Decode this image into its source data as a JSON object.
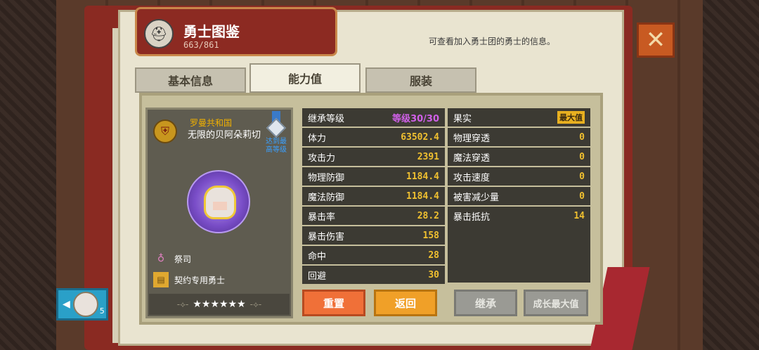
{
  "header": {
    "title": "勇士图鉴",
    "count": "663/861",
    "hint": "可查看加入勇士团的勇士的信息。"
  },
  "tabs": [
    {
      "label": "基本信息",
      "active": false
    },
    {
      "label": "能力值",
      "active": true
    },
    {
      "label": "服装",
      "active": false
    }
  ],
  "hero": {
    "nation": "罗曼共和国",
    "name": "无限的贝阿朵莉切",
    "max_level_label": "达到最高等级",
    "class": "祭司",
    "type": "契约专用勇士",
    "stars": "★★★★★★"
  },
  "stats_left": [
    {
      "label": "继承等级",
      "value": "等级30/30"
    },
    {
      "label": "体力",
      "value": "63502.4"
    },
    {
      "label": "攻击力",
      "value": "2391"
    },
    {
      "label": "物理防御",
      "value": "1184.4"
    },
    {
      "label": "魔法防御",
      "value": "1184.4"
    },
    {
      "label": "暴击率",
      "value": "28.2"
    },
    {
      "label": "暴击伤害",
      "value": "158"
    },
    {
      "label": "命中",
      "value": "28"
    },
    {
      "label": "回避",
      "value": "30"
    }
  ],
  "stats_right": [
    {
      "label": "果实",
      "value": "最大值"
    },
    {
      "label": "物理穿透",
      "value": "0"
    },
    {
      "label": "魔法穿透",
      "value": "0"
    },
    {
      "label": "攻击速度",
      "value": "0"
    },
    {
      "label": "被害减少量",
      "value": "0"
    },
    {
      "label": "暴击抵抗",
      "value": "14"
    }
  ],
  "buttons": {
    "reset": "重置",
    "back": "返回",
    "inherit": "继承",
    "growth_max": "成长最大值"
  },
  "close_label": "✕",
  "avatar": {
    "count": "5"
  },
  "icons": {
    "close": "close-icon",
    "helmet": "helmet-icon",
    "crest": "spartan-crest-icon",
    "medal": "medal-icon",
    "priest": "priest-class-icon",
    "scroll": "scroll-icon"
  },
  "colors": {
    "accent": "#f07038",
    "gold": "#f0c030",
    "purple": "#d060e8"
  }
}
